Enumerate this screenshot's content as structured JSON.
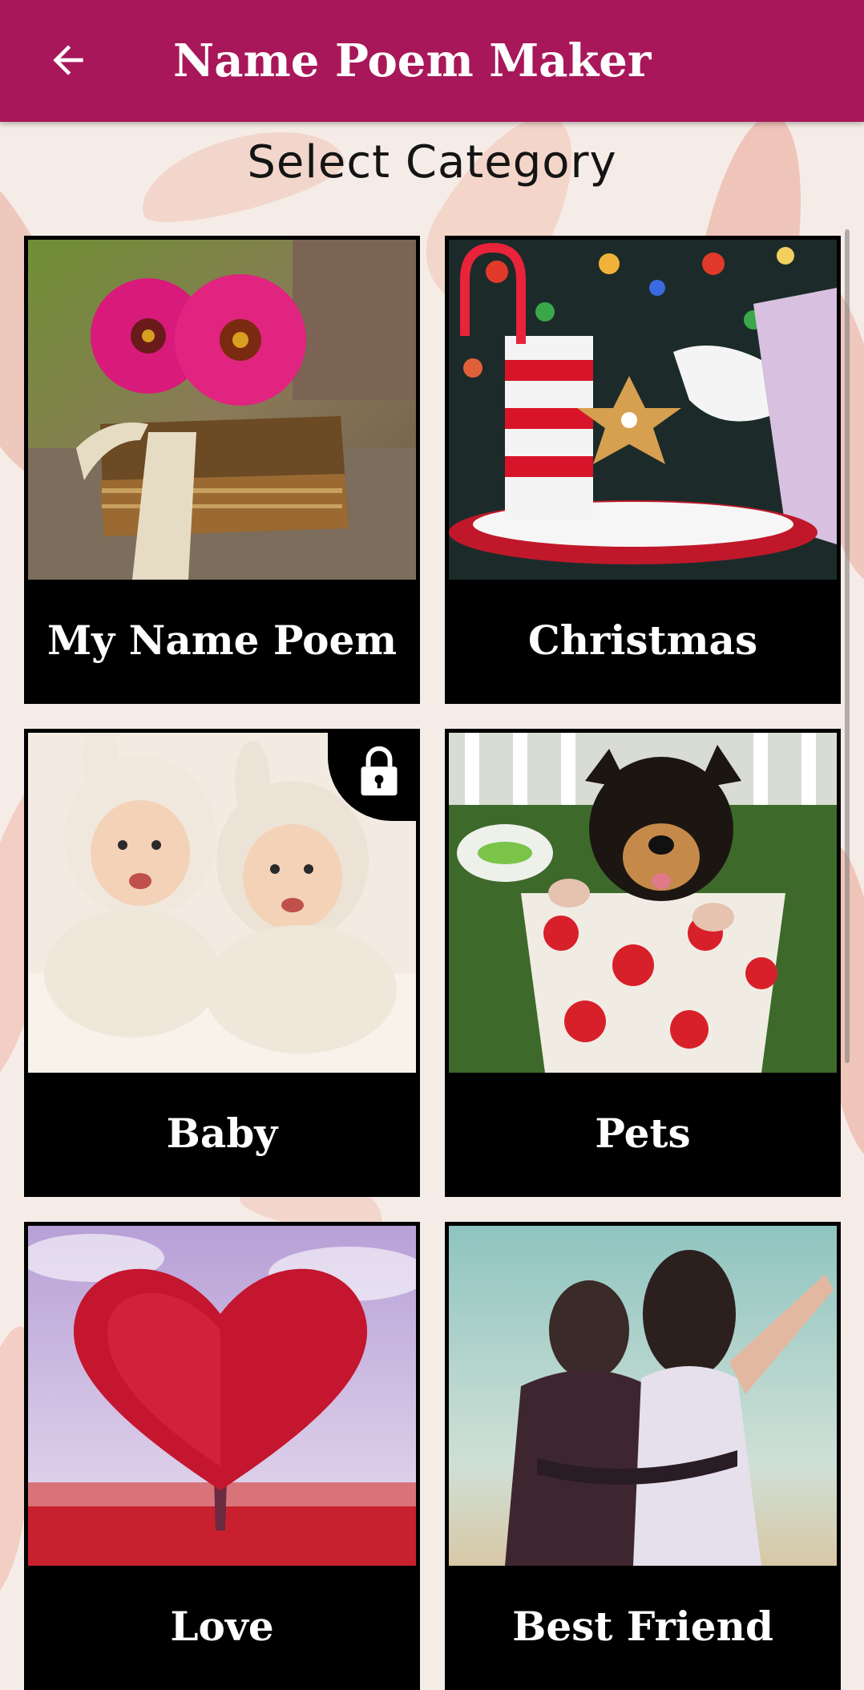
{
  "app_bar": {
    "title": "Name Poem Maker",
    "back_icon": "arrow-left-icon",
    "background": "#a8175a"
  },
  "main": {
    "heading": "Select Category",
    "categories": [
      {
        "label": "My Name Poem",
        "image": "pink-gerbera-flowers-on-book",
        "locked": false
      },
      {
        "label": "Christmas",
        "image": "santa-holding-cookie-with-candy-cane-mug",
        "locked": false
      },
      {
        "label": "Baby",
        "image": "twin-babies-in-bunny-hats",
        "locked": true,
        "lock_icon": "padlock-icon"
      },
      {
        "label": "Pets",
        "image": "puppy-in-polka-dot-cup",
        "locked": false
      },
      {
        "label": "Love",
        "image": "red-heart-shaped-tree",
        "locked": false
      },
      {
        "label": "Best Friend",
        "image": "two-friends-hugging",
        "locked": false
      }
    ]
  }
}
